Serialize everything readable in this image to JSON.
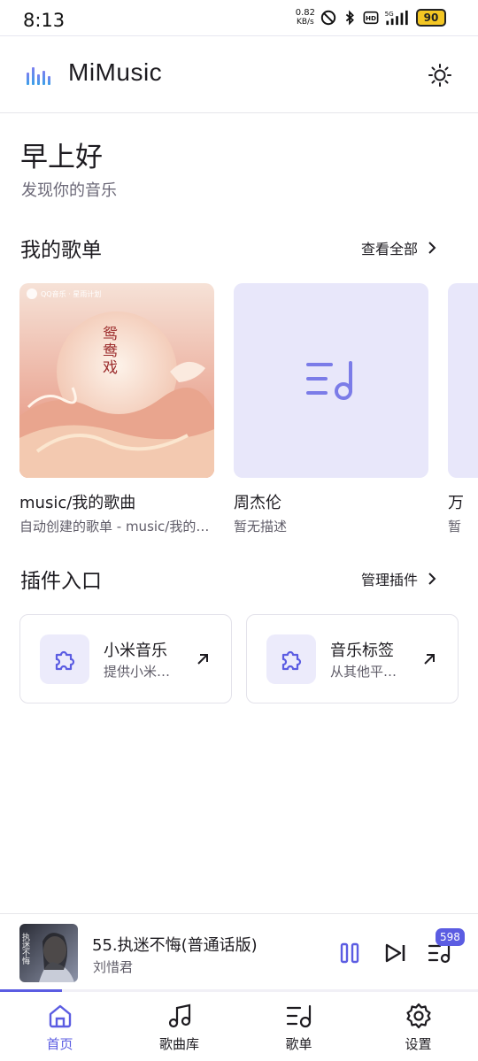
{
  "status_bar": {
    "time": "8:13",
    "net_speed_value": "0.82",
    "net_speed_unit": "KB/s",
    "network_type": "5G",
    "hd_label": "HD",
    "battery": "90"
  },
  "app": {
    "title": "MiMusic",
    "accent_color": "#5b5ce2"
  },
  "greeting": {
    "title": "早上好",
    "subtitle": "发现你的音乐"
  },
  "playlists_section": {
    "title": "我的歌单",
    "view_all": "查看全部",
    "items": [
      {
        "name": "music/我的歌曲",
        "desc": "自动创建的歌单 - music/我的歌曲"
      },
      {
        "name": "周杰伦",
        "desc": "暂无描述"
      },
      {
        "name": "万",
        "desc": "暂"
      }
    ],
    "cover_text": {
      "logo": "QQ音乐 · 星雨计划",
      "song_title": "鸳鸯戏"
    }
  },
  "plugins_section": {
    "title": "插件入口",
    "manage": "管理插件",
    "items": [
      {
        "name": "小米音乐",
        "desc": "提供小米音乐"
      },
      {
        "name": "音乐标签",
        "desc": "从其他平台获取"
      }
    ]
  },
  "now_playing": {
    "title": "55.执迷不悔(普通话版)",
    "artist": "刘惜君",
    "queue_count": "598",
    "progress": 0.13,
    "art_text": "执迷不悔"
  },
  "bottom_nav": {
    "items": [
      {
        "label": "首页",
        "icon": "home-icon",
        "active": true
      },
      {
        "label": "歌曲库",
        "icon": "music-note-icon",
        "active": false
      },
      {
        "label": "歌单",
        "icon": "playlist-icon",
        "active": false
      },
      {
        "label": "设置",
        "icon": "settings-icon",
        "active": false
      }
    ]
  }
}
